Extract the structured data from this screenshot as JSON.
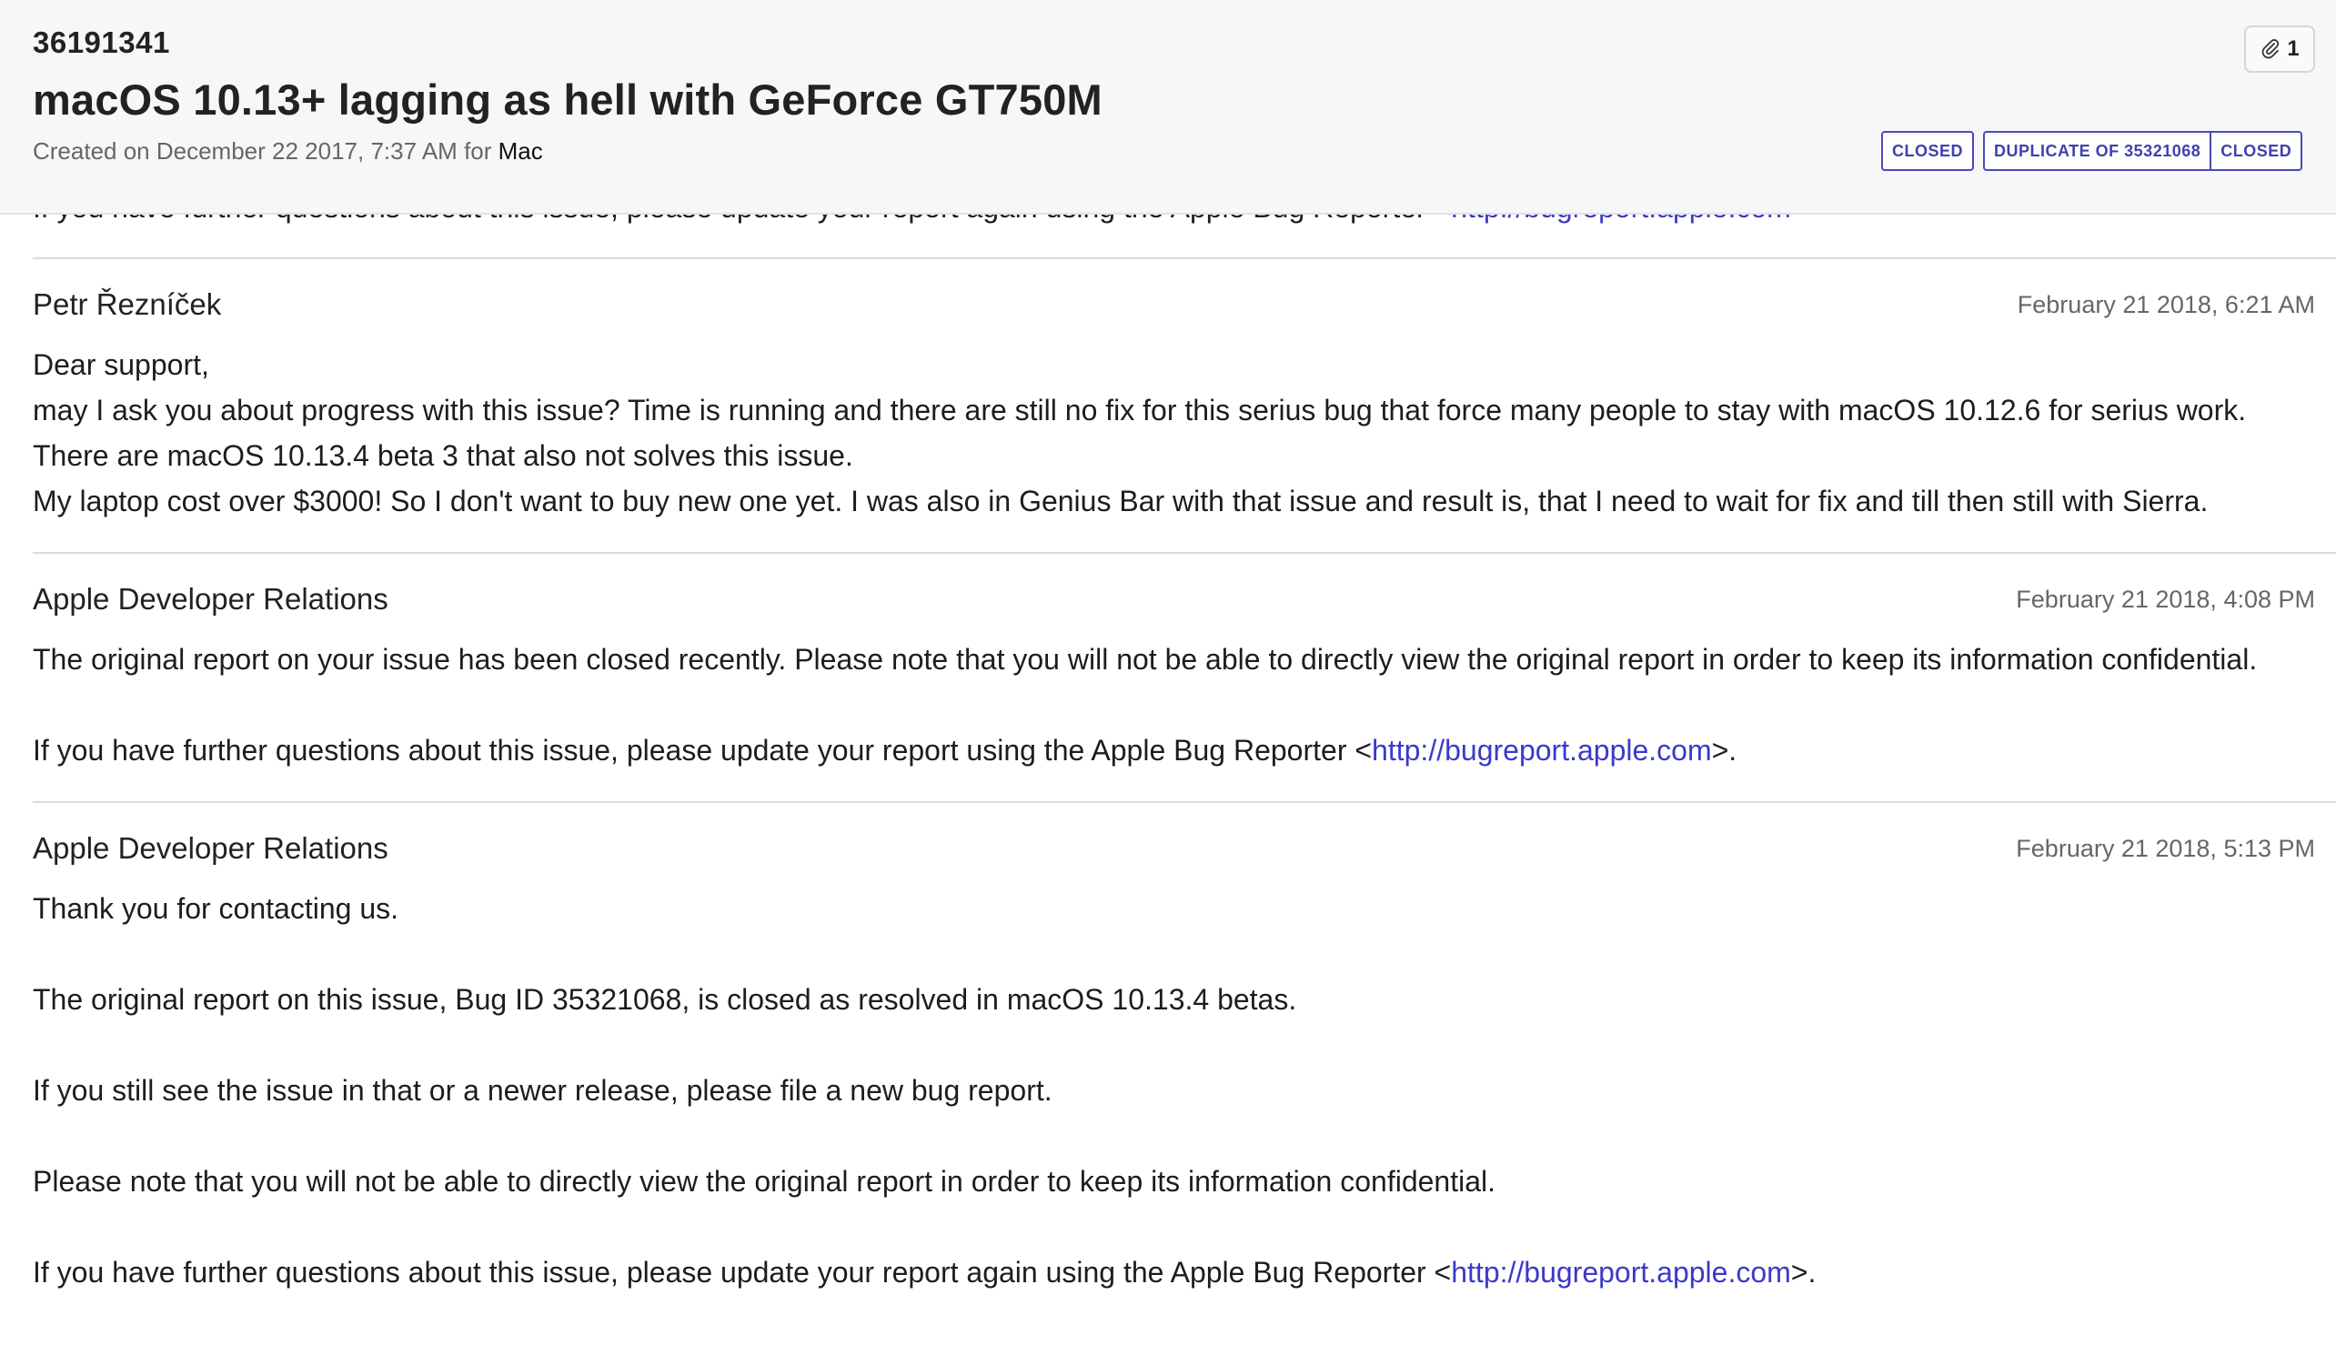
{
  "header": {
    "bug_id": "36191341",
    "title": "macOS 10.13+ lagging as hell with GeForce GT750M",
    "created_prefix": "Created on December 22 2017, 7:37 AM for ",
    "product": "Mac",
    "attachment_count": "1",
    "status_badge": "CLOSED",
    "duplicate_label": "DUPLICATE OF 35321068",
    "duplicate_status": "CLOSED",
    "accent_color": "#4040b0"
  },
  "clipped": {
    "text": "If you have further questions about this issue, please update your report again using the Apple Bug Reporter <",
    "link": "http://bugreport.apple.com"
  },
  "comments": [
    {
      "author": "Petr Řezníček",
      "date": "February 21 2018, 6:21 AM",
      "lines": [
        "Dear support,",
        "may I ask you about progress with this issue? Time is running and there are still no fix for this serius bug that force many people to stay with macOS 10.12.6 for serius work.",
        "There are macOS 10.13.4 beta 3 that also not solves this issue.",
        "My laptop cost over $3000! So I don't want to buy new one yet. I was also in Genius Bar with that issue and result is, that I need to wait for fix and till then still with Sierra."
      ]
    },
    {
      "author": "Apple Developer Relations",
      "date": "February 21 2018, 4:08 PM",
      "p1": "The original report on your issue has been closed recently. Please note that you will not be able to directly view the original report in order to keep its information confidential.",
      "p2_prefix": "If you have further questions about this issue, please update your report using the Apple Bug Reporter <",
      "p2_link": "http://bugreport.apple.com",
      "p2_suffix": ">."
    },
    {
      "author": "Apple Developer Relations",
      "date": "February 21 2018, 5:13 PM",
      "p1": "Thank you for contacting us.",
      "p2": "The original report on this issue, Bug ID 35321068, is closed as resolved in macOS 10.13.4 betas.",
      "p3": "If you still see the issue in that or a newer release, please file a new bug report.",
      "p4": "Please note that you will not be able to directly view the original report in order to keep its information confidential.",
      "p5_prefix": "If you have further questions about this issue, please update your report again using the Apple Bug Reporter <",
      "p5_link": "http://bugreport.apple.com",
      "p5_suffix": ">."
    }
  ]
}
